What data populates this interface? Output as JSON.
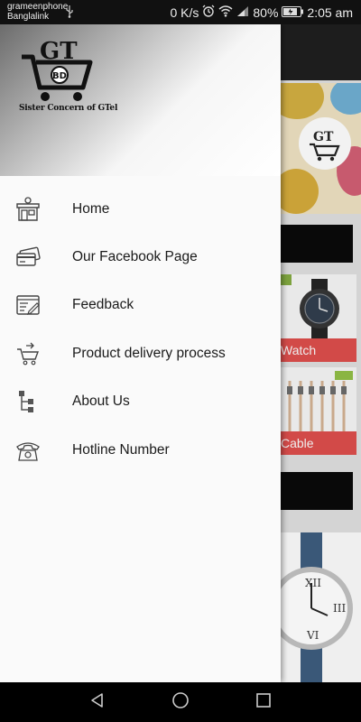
{
  "status_bar": {
    "carrier_primary": "grameenphone",
    "carrier_secondary": "Banglalink",
    "network_speed": "0 K/s",
    "battery_percent": "80%",
    "time": "2:05 am"
  },
  "drawer": {
    "logo": {
      "letters": "GT",
      "badge": "BD"
    },
    "tagline": "Sister Concern of GTel",
    "menu": [
      {
        "label": "Home",
        "icon": "storefront-icon"
      },
      {
        "label": "Our Facebook Page",
        "icon": "credit-card-icon"
      },
      {
        "label": "Feedback",
        "icon": "feedback-form-icon"
      },
      {
        "label": "Product delivery process",
        "icon": "cart-delivery-icon"
      },
      {
        "label": "About Us",
        "icon": "hierarchy-icon"
      },
      {
        "label": "Hotline Number",
        "icon": "telephone-icon"
      }
    ]
  },
  "background": {
    "card_1_label": "Watch",
    "card_2_label": "Cable"
  },
  "colors": {
    "accent_red": "#d24a48",
    "drawer_bg": "#fafafa",
    "status_bar_bg": "#111111"
  },
  "nav_bar": {
    "buttons": [
      "back-icon",
      "home-icon",
      "recents-icon"
    ]
  }
}
